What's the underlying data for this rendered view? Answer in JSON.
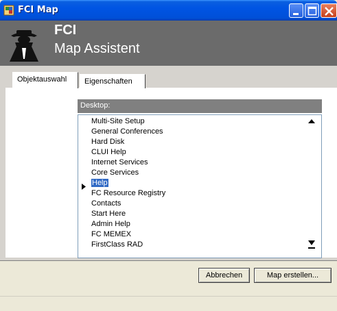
{
  "window": {
    "title": "FCI Map",
    "controls": {
      "minimize_icon": "minimize-icon",
      "maximize_icon": "maximize-icon",
      "close_icon": "close-icon"
    }
  },
  "banner": {
    "title": "FCI",
    "subtitle": "Map Assistent",
    "logo_icon": "spy-figure-logo"
  },
  "tabs": [
    {
      "label": "Objektauswahl",
      "active": true
    },
    {
      "label": "Eigenschaften",
      "active": false
    }
  ],
  "panel": {
    "header_label": "Desktop:",
    "items": [
      "Multi-Site Setup",
      "General Conferences",
      "Hard Disk",
      "CLUI Help",
      "Internet Services",
      "Core Services",
      "Help",
      "FC Resource Registry",
      "Contacts",
      "Start Here",
      "Admin Help",
      "FC MEMEX",
      "FirstClass RAD"
    ],
    "selected_item": "Help"
  },
  "buttons": {
    "cancel": "Abbrechen",
    "create": "Map erstellen..."
  },
  "colors": {
    "titlebar": "#0054e3",
    "banner": "#6b6b6b",
    "selection": "#316ac5",
    "header_label_bg": "#808080"
  }
}
